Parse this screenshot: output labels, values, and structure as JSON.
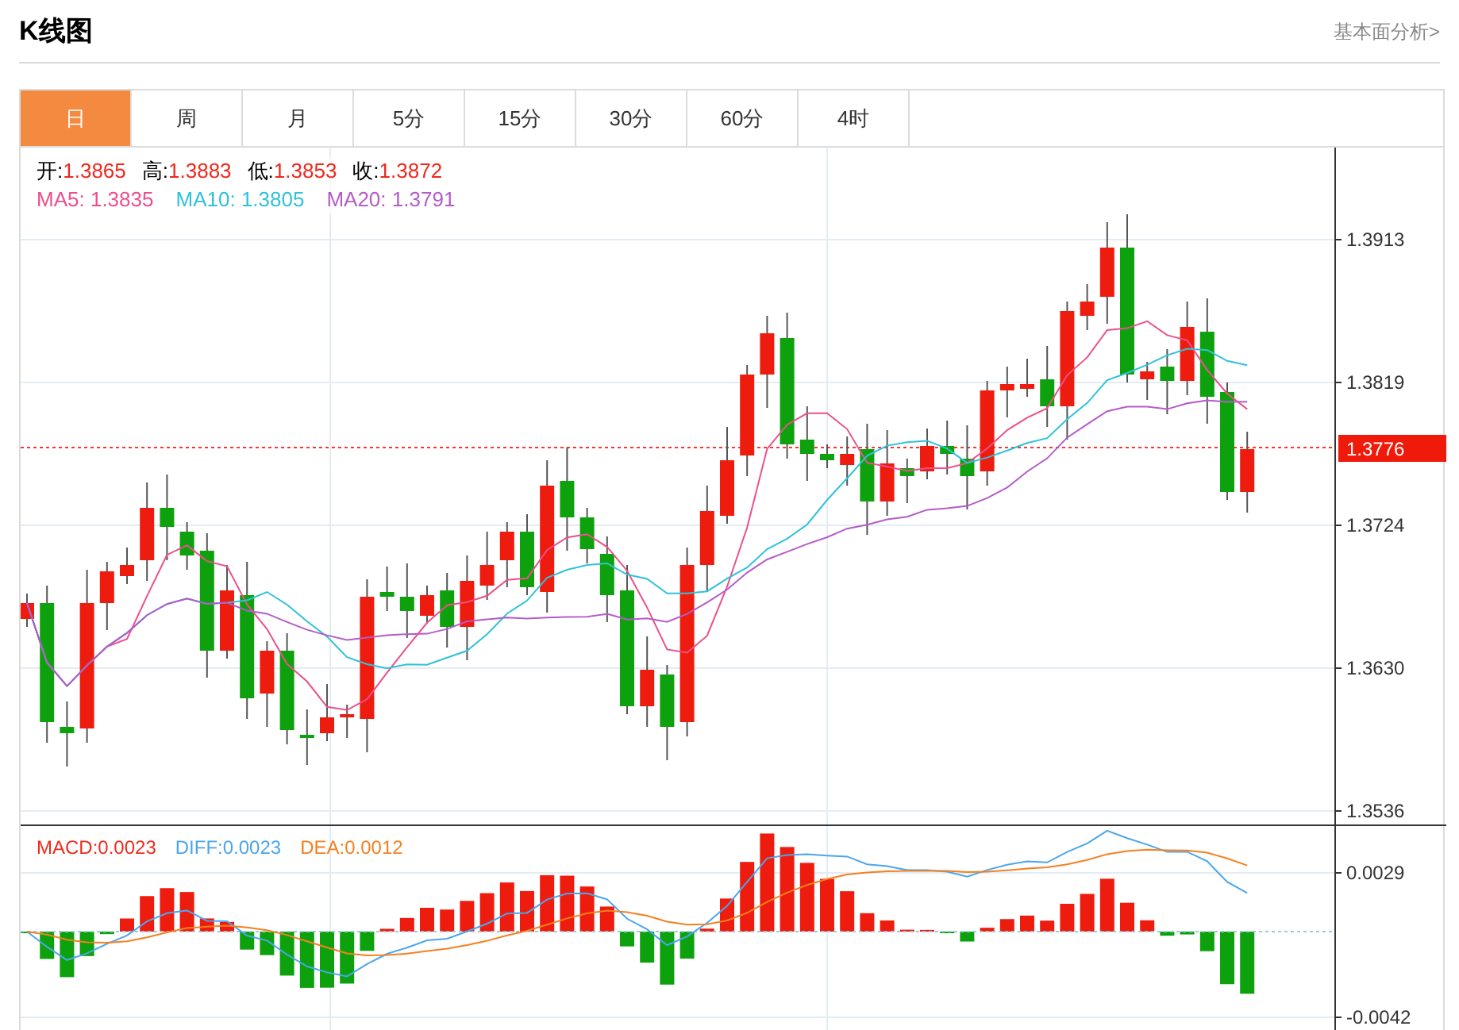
{
  "header": {
    "title": "K线图",
    "link": "基本面分析>"
  },
  "tabs": [
    {
      "label": "日",
      "selected": true
    },
    {
      "label": "周",
      "selected": false
    },
    {
      "label": "月",
      "selected": false
    },
    {
      "label": "5分",
      "selected": false
    },
    {
      "label": "15分",
      "selected": false
    },
    {
      "label": "30分",
      "selected": false
    },
    {
      "label": "60分",
      "selected": false
    },
    {
      "label": "4时",
      "selected": false
    }
  ],
  "ohlc_legend": [
    {
      "label": "开:",
      "value": "1.3865"
    },
    {
      "label": "高:",
      "value": "1.3883"
    },
    {
      "label": "低:",
      "value": "1.3853"
    },
    {
      "label": "收:",
      "value": "1.3872"
    }
  ],
  "ma_legend": [
    {
      "label": "MA5:",
      "value": "1.3835",
      "color": "#ec4f8c"
    },
    {
      "label": "MA10:",
      "value": "1.3805",
      "color": "#2fc2d9"
    },
    {
      "label": "MA20:",
      "value": "1.3791",
      "color": "#b55bc9"
    }
  ],
  "price_axis": {
    "ticks": [
      "1.3913",
      "1.3819",
      "1.3724",
      "1.3630",
      "1.3536"
    ],
    "current_price": "1.3776"
  },
  "macd_legend": [
    {
      "label": "MACD:",
      "value": "0.0023",
      "color": "#ee2b1c"
    },
    {
      "label": "DIFF:",
      "value": "0.0023",
      "color": "#4aa6ee"
    },
    {
      "label": "DEA:",
      "value": "0.0012",
      "color": "#f5801f"
    }
  ],
  "macd_axis": {
    "ticks": [
      "0.0029",
      "-0.0042"
    ]
  }
}
